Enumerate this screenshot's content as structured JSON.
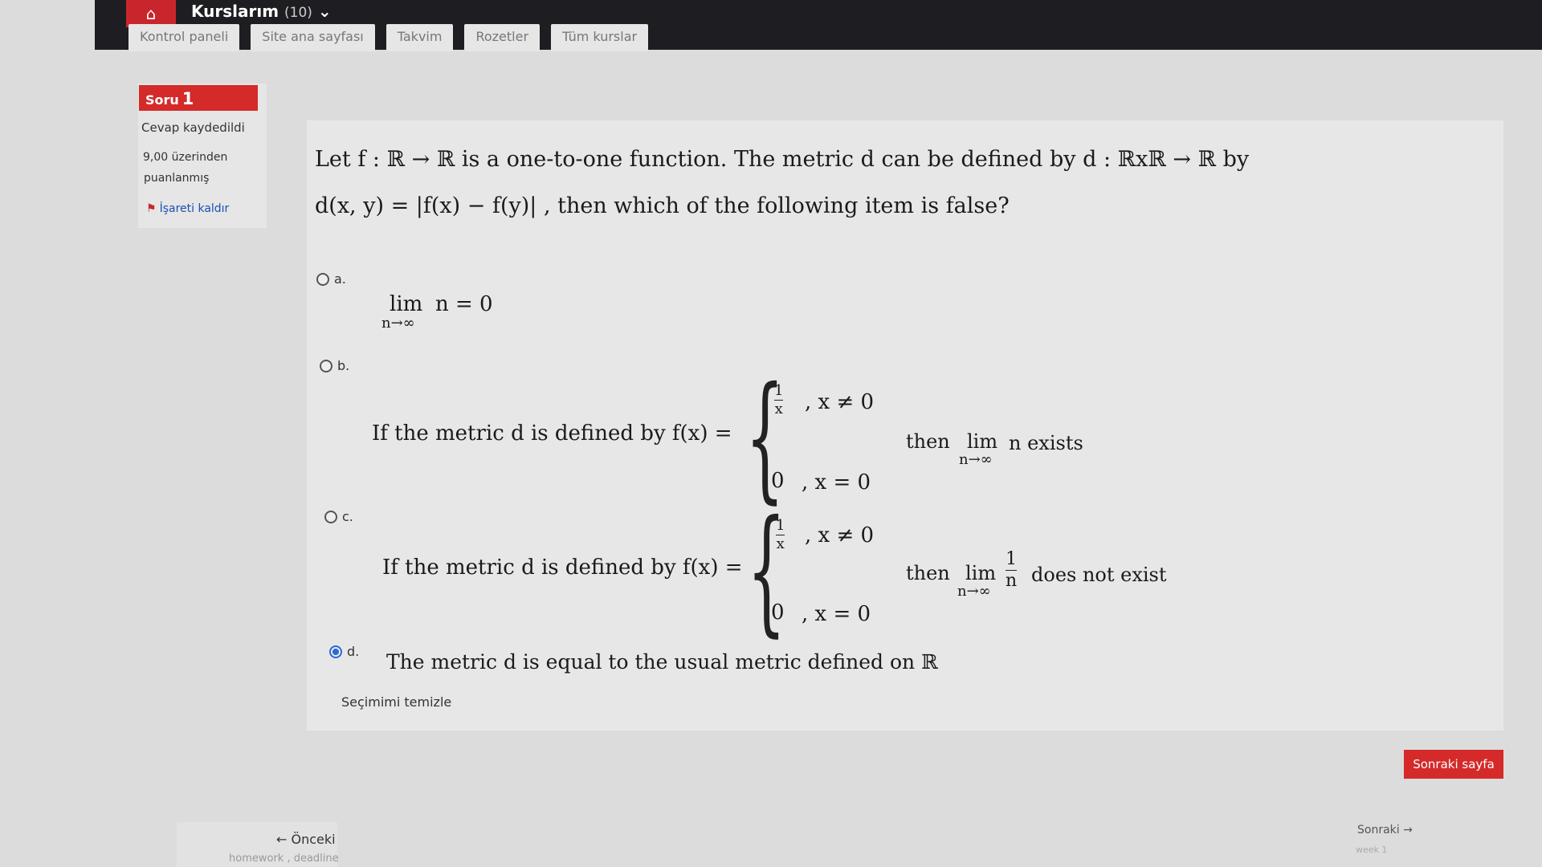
{
  "nav": {
    "courses_label": "Kurslarım",
    "courses_count": "(10)",
    "tabs": [
      "Kontrol paneli",
      "Site ana sayfası",
      "Takvim",
      "Rozetler",
      "Tüm kurslar"
    ]
  },
  "info": {
    "question_label": "Soru",
    "question_number": "1",
    "status": "Cevap kaydedildi",
    "points_line1": "9,00 üzerinden",
    "points_line2": "puanlanmış",
    "flag_label": "İşareti kaldır"
  },
  "question": {
    "line1": "Let f : ℝ → ℝ is a one-to-one function.  The metric d can be defined by d : ℝxℝ → ℝ by",
    "line2": "d(x, y) = |f(x) − f(y)| , then which of the following item is false?"
  },
  "options": {
    "a": {
      "letter": "a.",
      "lim": "lim",
      "sub": "n→∞",
      "expr": "n = 0"
    },
    "b": {
      "letter": "b.",
      "lead": "If the metric d is defined by f(x) =",
      "case1_num": "1",
      "case1_den": "x",
      "case1_cond": ",   x ≠ 0",
      "case2_val": "0",
      "case2_cond": ",   x = 0",
      "then": "then",
      "lim": "lim",
      "sub": "n→∞",
      "tail": "n exists"
    },
    "c": {
      "letter": "c.",
      "lead": "If the metric d is defined by f(x) =",
      "case1_num": "1",
      "case1_den": "x",
      "case1_cond": ",   x ≠ 0",
      "case2_val": "0",
      "case2_cond": ",   x = 0",
      "then": "then",
      "lim": "lim",
      "sub": "n→∞",
      "frac_num": "1",
      "frac_den": "n",
      "tail": "does not exist"
    },
    "d": {
      "letter": "d.",
      "text": "The metric d is equal to the usual metric defined on ℝ",
      "selected": true
    }
  },
  "clear_label": "Seçimimi temizle",
  "next_page_label": "Sonraki sayfa",
  "footer": {
    "prev_label": "← Önceki",
    "prev_sub": "homework , deadline",
    "next_label": "Sonraki →",
    "next_sub": "week 1"
  },
  "colors": {
    "accent": "#d42a2a",
    "topbar": "#1e1e22",
    "radio": "#2a6bd6"
  }
}
